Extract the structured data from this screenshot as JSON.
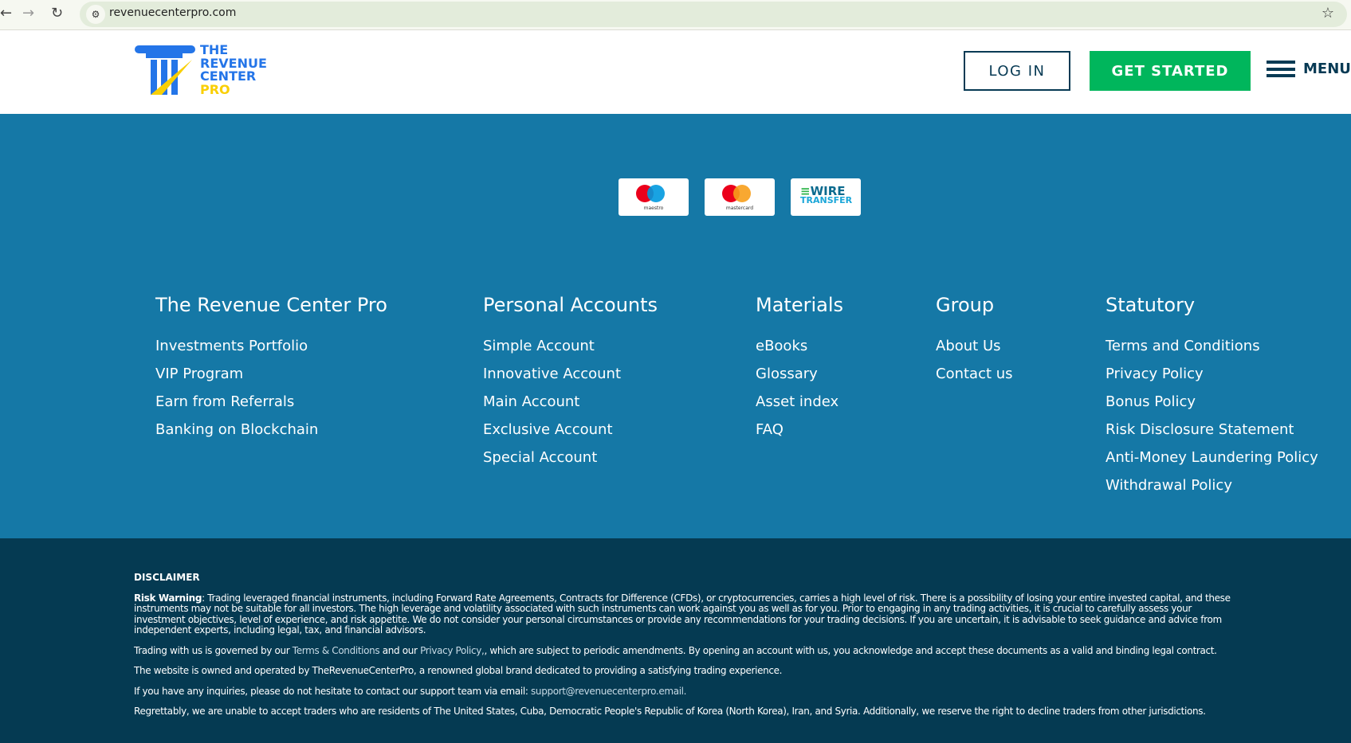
{
  "browser": {
    "url": "revenuecenterpro.com"
  },
  "header": {
    "logo_lines": [
      "THE",
      "REVENUE",
      "CENTER",
      "PRO"
    ],
    "login": "LOG IN",
    "get_started": "GET STARTED",
    "menu": "MENU"
  },
  "payments": [
    {
      "name": "maestro"
    },
    {
      "name": "mastercard"
    },
    {
      "name": "WIRE",
      "sub": "TRANSFER"
    }
  ],
  "columns": [
    {
      "title": "The Revenue Center Pro",
      "links": [
        "Investments Portfolio",
        "VIP Program",
        "Earn from Referrals",
        "Banking on Blockchain"
      ]
    },
    {
      "title": "Personal Accounts",
      "links": [
        "Simple Account",
        "Innovative Account",
        "Main Account",
        "Exclusive Account",
        "Special Account"
      ]
    },
    {
      "title": "Materials",
      "links": [
        "eBooks",
        "Glossary",
        "Asset index",
        "FAQ"
      ]
    },
    {
      "title": "Group",
      "links": [
        "About Us",
        "Contact us"
      ]
    },
    {
      "title": "Statutory",
      "links": [
        "Terms and Conditions",
        "Privacy Policy",
        "Bonus Policy",
        "Risk Disclosure Statement",
        "Anti-Money Laundering Policy",
        "Withdrawal Policy"
      ]
    }
  ],
  "disclaimer": {
    "title": "DISCLAIMER",
    "risk_label": "Risk Warning",
    "risk_text": ":  Trading leveraged financial instruments, including Forward Rate Agreements, Contracts for Difference (CFDs), or cryptocurrencies, carries a high level of risk. There is a possibility of losing your entire invested capital, and these instruments may not be suitable for all investors. The high leverage and volatility associated with such instruments can work against you as well as for you. Prior to engaging in any trading activities, it is crucial to carefully assess your investment objectives, level of experience, and risk appetite. We do not consider your personal circumstances or provide any recommendations for your trading decisions. If you are uncertain, it is advisable to seek guidance and advice from independent experts, including legal, tax, and financial advisors.",
    "gov_1": "Trading with us is governed by our ",
    "terms_link": "Terms & Conditions",
    "gov_2": " and our ",
    "privacy_link": "Privacy Policy,",
    "gov_3": ", which are subject to periodic amendments. By opening an account with us, you acknowledge and accept these documents as a valid and binding legal contract.",
    "owned": "The website is owned and operated by TheRevenueCenterPro, a renowned global brand dedicated to providing a satisfying trading experience.",
    "contact": "If you have any inquiries, please do not hesitate to contact our support team via email: ",
    "email": "support@revenuecenterpro.email.",
    "restrict": "Regrettably, we are unable to accept traders who are residents of The United States, Cuba, Democratic People's Republic of Korea (North Korea), Iran, and Syria. Additionally, we reserve the right to decline traders from other jurisdictions."
  }
}
